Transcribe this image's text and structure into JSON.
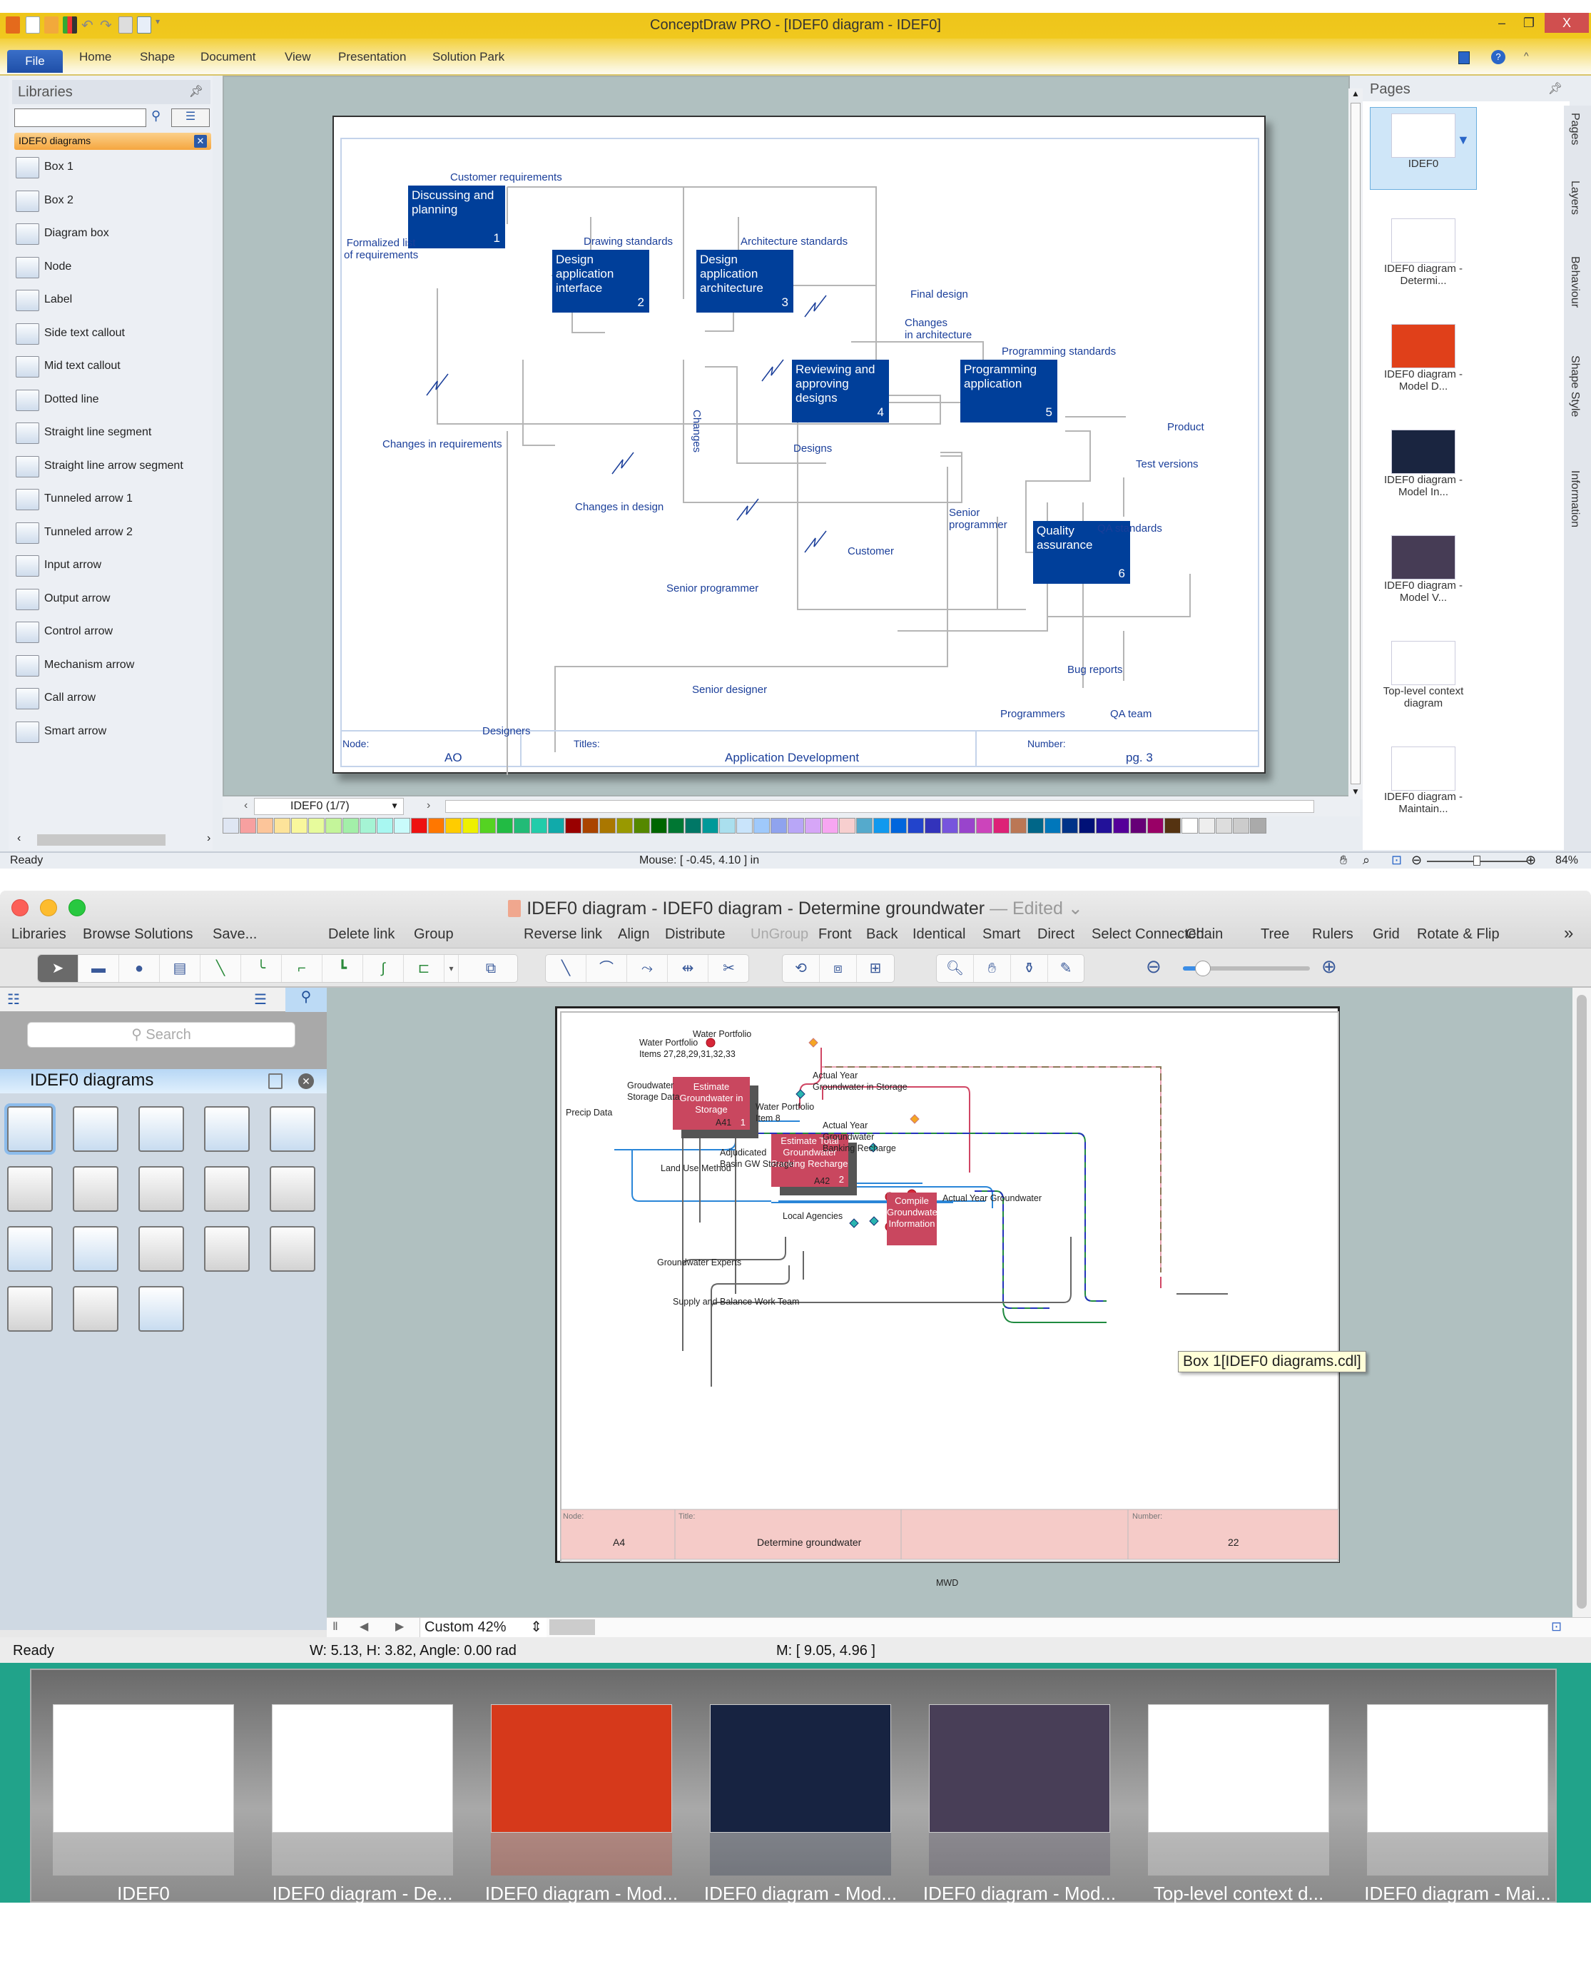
{
  "windows_app": {
    "title": "ConceptDraw PRO - [IDEF0 diagram - IDEF0]",
    "ribbon_tabs": [
      "File",
      "Home",
      "Shape",
      "Document",
      "View",
      "Presentation",
      "Solution Park"
    ],
    "window_controls": {
      "minimize": "–",
      "restore": "❐",
      "close": "X"
    },
    "libraries": {
      "title": "Libraries",
      "search_value": "",
      "category": "IDEF0 diagrams",
      "items": [
        {
          "label": "Box 1",
          "icon": "box1-icon"
        },
        {
          "label": "Box 2",
          "icon": "box2-icon"
        },
        {
          "label": "Diagram box",
          "icon": "diagram-box-icon"
        },
        {
          "label": "Node",
          "icon": "node-icon"
        },
        {
          "label": "Label",
          "icon": "label-icon"
        },
        {
          "label": "Side text callout",
          "icon": "side-callout-icon"
        },
        {
          "label": "Mid text callout",
          "icon": "mid-callout-icon"
        },
        {
          "label": "Dotted line",
          "icon": "dotted-line-icon"
        },
        {
          "label": "Straight line segment",
          "icon": "line-segment-icon"
        },
        {
          "label": "Straight line arrow segment",
          "icon": "arrow-segment-icon"
        },
        {
          "label": "Tunneled arrow 1",
          "icon": "tunneled-arrow-icon"
        },
        {
          "label": "Tunneled arrow 2",
          "icon": "tunneled-arrow-icon"
        },
        {
          "label": "Input arrow",
          "icon": "input-arrow-icon"
        },
        {
          "label": "Output arrow",
          "icon": "output-arrow-icon"
        },
        {
          "label": "Control arrow",
          "icon": "control-arrow-icon"
        },
        {
          "label": "Mechanism arrow",
          "icon": "mechanism-arrow-icon"
        },
        {
          "label": "Call arrow",
          "icon": "call-arrow-icon"
        },
        {
          "label": "Smart arrow",
          "icon": "smart-arrow-icon"
        }
      ]
    },
    "diagram": {
      "boxes": [
        {
          "text": "Discussing and planning",
          "num": "1"
        },
        {
          "text": "Design application interface",
          "num": "2"
        },
        {
          "text": "Design application architecture",
          "num": "3"
        },
        {
          "text": "Reviewing and approving designs",
          "num": "4"
        },
        {
          "text": "Programming application",
          "num": "5"
        },
        {
          "text": "Quality assurance",
          "num": "6"
        }
      ],
      "labels": {
        "customer_requirements": "Customer requirements",
        "formalized_list": "Formalized list\nof requirements",
        "drawing_standards": "Drawing standards",
        "architecture_standards": "Architecture standards",
        "final_design": "Final design",
        "changes_in_architecture": "Changes\nin architecture",
        "programming_standards": "Programming standards",
        "product": "Product",
        "test_versions": "Test versions",
        "changes_in_requirements": "Changes in requirements",
        "changes": "Changes",
        "designs": "Designs",
        "changes_in_design": "Changes in design",
        "customer": "Customer",
        "senior_programmer_1": "Senior\nprogrammer",
        "senior_programmer_2": "Senior programmer",
        "qa_standards": "QA standards",
        "bug_reports": "Bug reports",
        "senior_designer": "Senior designer",
        "designers": "Designers",
        "programmers": "Programmers",
        "qa_team": "QA team"
      },
      "footer": {
        "node_label": "Node:",
        "node_value": "AO",
        "title_label": "Titles:",
        "title_value": "Application Development",
        "number_label": "Number:",
        "number_value": "pg. 3"
      }
    },
    "page_selector": "IDEF0 (1/7)",
    "palette": [
      "#f7a0a0",
      "#fcc59a",
      "#fde39a",
      "#f9f79c",
      "#e7fb9c",
      "#c4f59a",
      "#a3efa9",
      "#a5f4d4",
      "#a8f7f1",
      "#c9fbfb",
      "#ee1111",
      "#ff7700",
      "#ffcc00",
      "#eef000",
      "#55d322",
      "#22bb44",
      "#22bb77",
      "#22ccaa",
      "#11aaaa",
      "#990000",
      "#aa4400",
      "#aa7700",
      "#999900",
      "#558800",
      "#006600",
      "#007733",
      "#007766",
      "#009999",
      "#aadfee",
      "#c9e4fb",
      "#9fc9fb",
      "#8fa3ee",
      "#b8a6f7",
      "#d6a6f7",
      "#f7a6f1",
      "#f7cfcf",
      "#55aacc",
      "#1199ee",
      "#0066dd",
      "#2244cc",
      "#3333bb",
      "#7755dd",
      "#9944cc",
      "#cc44bb",
      "#dd2277",
      "#bb7755",
      "#006688",
      "#0077bb",
      "#003388",
      "#001177",
      "#221199",
      "#550099",
      "#660077",
      "#990066",
      "#553311",
      "#ffffff",
      "#eeeeee",
      "#dddddd",
      "#cccccc",
      "#aaaaaa"
    ],
    "pages_panel": {
      "title": "Pages",
      "pages": [
        {
          "label": "IDEF0",
          "selected": true,
          "thumb_color": "#ffffff"
        },
        {
          "label": "IDEF0 diagram -\nDetermi...",
          "thumb_color": "#ffffff"
        },
        {
          "label": "IDEF0 diagram -\nModel D...",
          "thumb_color": "#e0401a"
        },
        {
          "label": "IDEF0 diagram -\nModel In...",
          "thumb_color": "#1a2540"
        },
        {
          "label": "IDEF0 diagram -\nModel V...",
          "thumb_color": "#463c55"
        },
        {
          "label": "Top-level context\ndiagram",
          "thumb_color": "#ffffff"
        },
        {
          "label": "IDEF0 diagram -\nMaintain...",
          "thumb_color": "#ffffff"
        }
      ]
    },
    "side_tabs": [
      "Pages",
      "Layers",
      "Behaviour",
      "Shape Style",
      "Information"
    ],
    "status": {
      "left": "Ready",
      "mouse": "Mouse: [ -0.45, 4.10 ] in",
      "zoom": "84%",
      "zoom_fraction": 0.5
    }
  },
  "mac_app": {
    "title": "IDEF0 diagram - IDEF0 diagram - Determine groundwater",
    "edited": "— Edited ⌄",
    "menu": [
      "Libraries",
      "Browse Solutions",
      "Save...",
      "Delete link",
      "Group",
      "Reverse link",
      "Align",
      "Distribute",
      "UnGroup",
      "Front",
      "Back",
      "Identical",
      "Smart",
      "Direct",
      "Select Connected",
      "Chain",
      "Tree",
      "Rulers",
      "Grid",
      "Rotate & Flip"
    ],
    "menu_disabled": [
      "UnGroup"
    ],
    "menu_more": "»",
    "zoom_slider_fraction": 0.15,
    "library": {
      "search_placeholder": "Search",
      "category": "IDEF0 diagrams"
    },
    "diagram": {
      "boxes": [
        {
          "text": "Estimate Groundwater in Storage",
          "num": "1",
          "ref": "A41"
        },
        {
          "text": "Estimate Total Groundwater Banking Recharge",
          "num": "2",
          "ref": "A42"
        },
        {
          "text": "Compile Groundwater Information",
          "num": ""
        }
      ],
      "labels": {
        "water_portfolio": "Water Portfolio",
        "water_portfolio_items": "Water Portfolio\nItems 27,28,29,31,32,33",
        "groundwater_storage_data": "Groudwater\nStorage Data",
        "precip_data": "Precip Data",
        "actual_year_gw_storage": "Actual Year\nGroundwater in Storage",
        "water_portfolio_item8": "Water Portfolio\nItem 8",
        "actual_year_banking": "Actual Year\nGroundwater\nBanking Recharge",
        "adjudicated": "Adjudicated\nBasin GW Storage",
        "land_use_method": "Land Use Method",
        "local_agencies": "Local Agencies",
        "actual_year_groundwater": "Actual Year Groundwater",
        "groundwater_experts": "Groundwater Experts",
        "supply_balance": "Supply and Balance Work Team",
        "mwd": "MWD"
      },
      "footer": {
        "node_label": "Node:",
        "node_value": "A4",
        "title_label": "Title:",
        "title_value": "Determine groundwater",
        "number_label": "Number:",
        "number_value": "22"
      },
      "tooltip": "Box 1[IDEF0 diagrams.cdl]"
    },
    "zoom_select": "Custom 42%",
    "status": {
      "left": "Ready",
      "dims": "W: 5.13,  H: 3.82,  Angle: 0.00 rad",
      "mouse": "M: [ 9.05, 4.96 ]"
    }
  },
  "gallery": [
    {
      "label": "IDEF0",
      "color": "#ffffff"
    },
    {
      "label": "IDEF0 diagram - De...",
      "color": "#ffffff"
    },
    {
      "label": "IDEF0 diagram - Mod...",
      "color": "#d6391b"
    },
    {
      "label": "IDEF0 diagram - Mod...",
      "color": "#172341"
    },
    {
      "label": "IDEF0 diagram - Mod...",
      "color": "#483e57"
    },
    {
      "label": "Top-level context d...",
      "color": "#ffffff"
    },
    {
      "label": "IDEF0 diagram - Mai...",
      "color": "#ffffff"
    }
  ]
}
